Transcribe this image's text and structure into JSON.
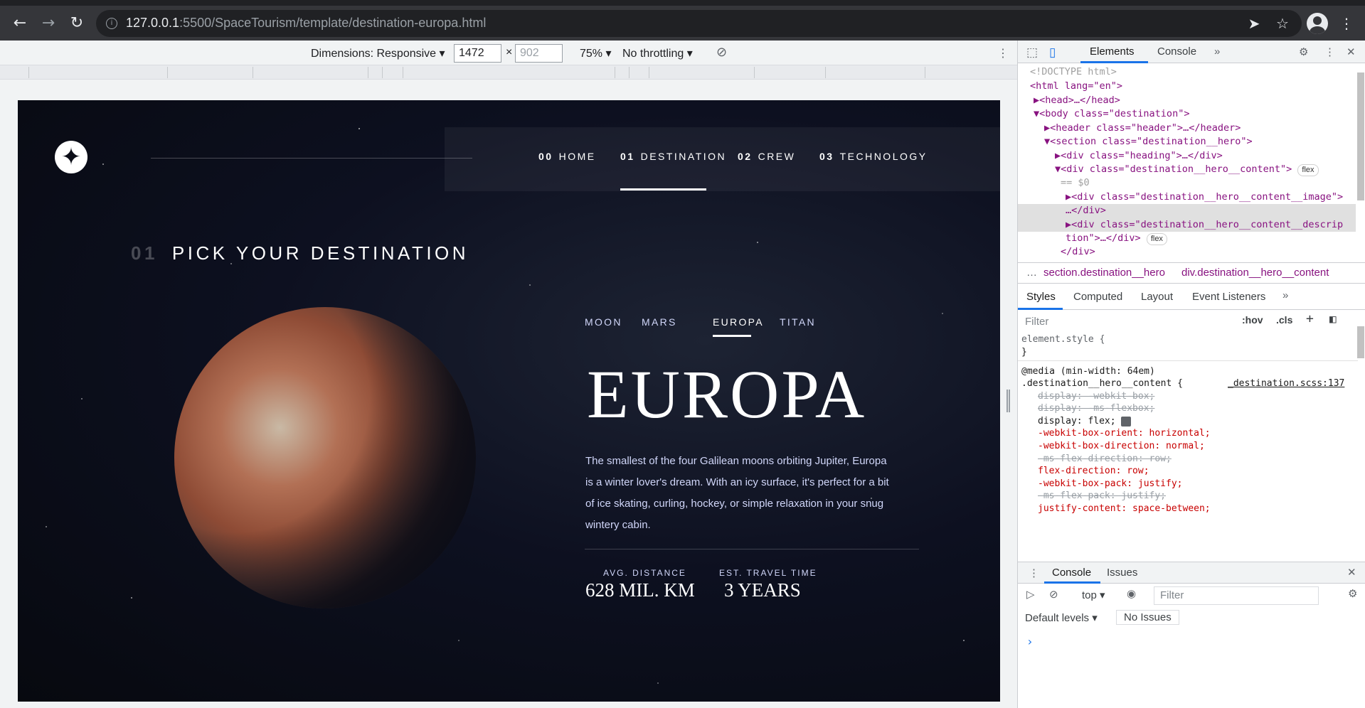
{
  "browser": {
    "url_host": "127.0.0.1",
    "url_rest": ":5500/SpaceTourism/template/destination-europa.html"
  },
  "device_toolbar": {
    "dimensions_label": "Dimensions: Responsive",
    "width": "1472",
    "height": "902",
    "zoom": "75%",
    "throttling": "No throttling"
  },
  "site": {
    "nav": [
      {
        "num": "00",
        "label": "HOME"
      },
      {
        "num": "01",
        "label": "DESTINATION"
      },
      {
        "num": "02",
        "label": "CREW"
      },
      {
        "num": "03",
        "label": "TECHNOLOGY"
      }
    ],
    "section_num": "01",
    "section_title": "PICK YOUR DESTINATION",
    "tabs": [
      "MOON",
      "MARS",
      "EUROPA",
      "TITAN"
    ],
    "active_tab": "EUROPA",
    "destination": "EUROPA",
    "description": "The smallest of the four Galilean moons orbiting Jupiter, Europa is a winter lover's dream. With an icy surface, it's perfect for a bit of ice skating, curling, hockey, or simple relaxation in your snug wintery cabin.",
    "stats": [
      {
        "label": "AVG. DISTANCE",
        "value": "628 MIL. KM"
      },
      {
        "label": "EST. TRAVEL TIME",
        "value": "3 YEARS"
      }
    ]
  },
  "devtools": {
    "tabs": [
      "Elements",
      "Console"
    ],
    "dom_lines": [
      "<!DOCTYPE html>",
      "<html lang=\"en\">",
      "▶<head>…</head>",
      "▼<body class=\"destination\">",
      "▶<header class=\"header\">…</header>",
      "▼<section class=\"destination__hero\">",
      "▶<div class=\"heading\">…</div>",
      "▼<div class=\"destination__hero__content\">",
      "== $0",
      "▶<div class=\"destination__hero__content__image\">",
      "…</div>",
      "▶<div class=\"destination__hero__content__descrip",
      "tion\">…</div>",
      "</div>"
    ],
    "flex_badge": "flex",
    "breadcrumbs": [
      "section.destination__hero",
      "div.destination__hero__content"
    ],
    "styles_tabs": [
      "Styles",
      "Computed",
      "Layout",
      "Event Listeners"
    ],
    "styles_filter_placeholder": "Filter",
    "hov": ":hov",
    "cls": ".cls",
    "css_lines": [
      {
        "text": "element.style {",
        "kind": "plain"
      },
      {
        "text": "}",
        "kind": "plain"
      },
      {
        "text": "@media (min-width: 64em)",
        "kind": "plain"
      },
      {
        "text": ".destination__hero__content {",
        "kind": "plain"
      },
      {
        "text": "display: -webkit-box;",
        "kind": "strike"
      },
      {
        "text": "display: -ms-flexbox;",
        "kind": "strike"
      },
      {
        "text": "display: flex;",
        "kind": "prop"
      },
      {
        "text": "-webkit-box-orient: horizontal;",
        "kind": "prop"
      },
      {
        "text": "-webkit-box-direction: normal;",
        "kind": "prop"
      },
      {
        "text": "-ms-flex-direction: row;",
        "kind": "strike"
      },
      {
        "text": "flex-direction: row;",
        "kind": "prop"
      },
      {
        "text": "-webkit-box-pack: justify;",
        "kind": "prop"
      },
      {
        "text": "-ms-flex-pack: justify;",
        "kind": "strike"
      },
      {
        "text": "justify-content: space-between;",
        "kind": "prop"
      }
    ],
    "css_source": "_destination.scss:137",
    "console": {
      "tabs": [
        "Console",
        "Issues"
      ],
      "context": "top",
      "filter_placeholder": "Filter",
      "levels": "Default levels",
      "issues": "No Issues",
      "prompt": "›"
    }
  }
}
